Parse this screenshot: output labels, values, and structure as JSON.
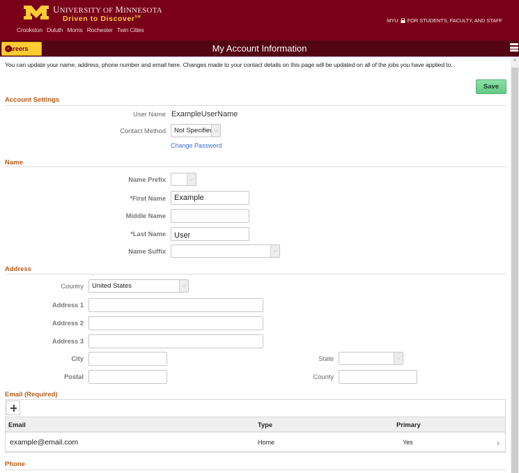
{
  "brand": {
    "university_first": "U",
    "university_rest": "NIVERSITY OF ",
    "university_m": "M",
    "university_end": "INNESOTA",
    "tagline": "Driven to Discover",
    "tagline_mark": "SM",
    "campuses": [
      "Crookston",
      "Duluth",
      "Morris",
      "Rochester",
      "Twin Cities"
    ],
    "myu_label": "MYU",
    "myu_tagline": "FOR STUDENTS, FACULTY, AND STAFF",
    "colors": {
      "maroon": "#7a0019",
      "gold": "#ffcc33"
    }
  },
  "title_bar": {
    "back_label": "Careers",
    "page_title": "My Account Information"
  },
  "intro_text": "You can update your name, address, phone number and email here. Changes made to your contact details on this page will be updated on all of the jobs you have applied to.",
  "save_label": "Save",
  "account_settings": {
    "title": "Account Settings",
    "user_name_label": "User Name",
    "user_name_value": "ExampleUserName",
    "contact_method_label": "Contact Method",
    "contact_method_value": "Not Specified",
    "change_password_label": "Change Password"
  },
  "name": {
    "title": "Name",
    "prefix_label": "Name Prefix",
    "prefix_value": "",
    "first_label": "*First Name",
    "first_value": "Example",
    "middle_label": "Middle Name",
    "middle_value": "",
    "last_label": "*Last Name",
    "last_value": "User",
    "suffix_label": "Name Suffix",
    "suffix_value": ""
  },
  "address": {
    "title": "Address",
    "country_label": "Country",
    "country_value": "United States",
    "address1_label": "Address 1",
    "address1_value": "",
    "address2_label": "Address 2",
    "address2_value": "",
    "address3_label": "Address 3",
    "address3_value": "",
    "city_label": "City",
    "city_value": "",
    "postal_label": "Postal",
    "postal_value": "",
    "state_label": "State",
    "state_value": "",
    "county_label": "County",
    "county_value": ""
  },
  "email": {
    "title": "Email (Required)",
    "columns": [
      "Email",
      "Type",
      "Primary"
    ],
    "rows": [
      {
        "email": "example@email.com",
        "type": "Home",
        "primary": "Yes"
      }
    ]
  },
  "phone": {
    "title": "Phone"
  }
}
